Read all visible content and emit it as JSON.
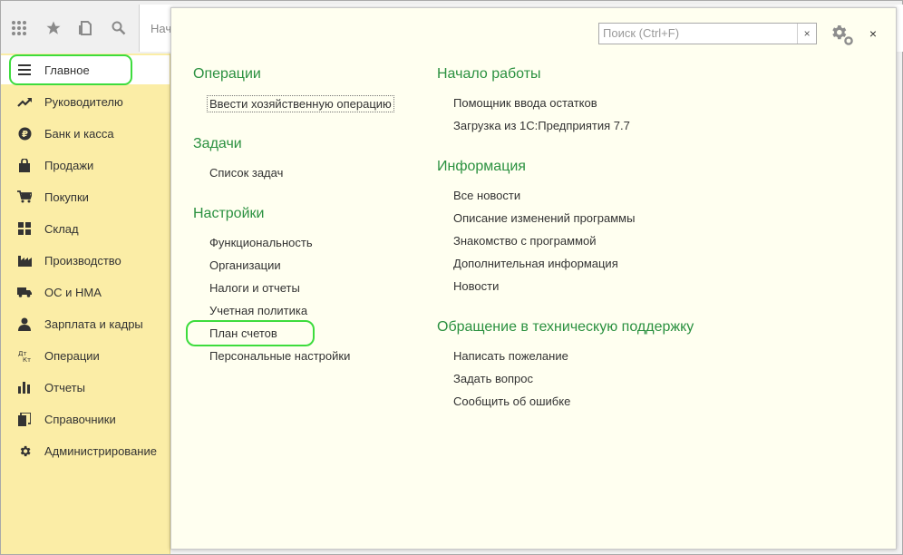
{
  "toolbar": {
    "icons": [
      "apps-grid-icon",
      "star-icon",
      "history-icon",
      "search-icon"
    ],
    "tab_label": "Нач"
  },
  "sidebar": {
    "items": [
      {
        "label": "Главное",
        "icon": "menu-lines-icon",
        "active": true
      },
      {
        "label": "Руководителю",
        "icon": "trend-icon"
      },
      {
        "label": "Банк и касса",
        "icon": "ruble-coin-icon"
      },
      {
        "label": "Продажи",
        "icon": "shopping-bag-icon"
      },
      {
        "label": "Покупки",
        "icon": "cart-icon"
      },
      {
        "label": "Склад",
        "icon": "warehouse-icon"
      },
      {
        "label": "Производство",
        "icon": "factory-icon"
      },
      {
        "label": "ОС и НМА",
        "icon": "truck-icon"
      },
      {
        "label": "Зарплата и кадры",
        "icon": "person-icon"
      },
      {
        "label": "Операции",
        "icon": "debit-credit-icon"
      },
      {
        "label": "Отчеты",
        "icon": "bar-chart-icon"
      },
      {
        "label": "Справочники",
        "icon": "books-icon"
      },
      {
        "label": "Администрирование",
        "icon": "gear-icon"
      }
    ]
  },
  "panel": {
    "search_placeholder": "Поиск (Ctrl+F)",
    "search_clear": "×",
    "close": "×",
    "left": {
      "operations": {
        "title": "Операции",
        "links": [
          "Ввести хозяйственную операцию"
        ]
      },
      "tasks": {
        "title": "Задачи",
        "links": [
          "Список задач"
        ]
      },
      "settings": {
        "title": "Настройки",
        "links": [
          "Функциональность",
          "Организации",
          "Налоги и отчеты",
          "Учетная политика",
          "План счетов",
          "Персональные настройки"
        ]
      }
    },
    "right": {
      "start": {
        "title": "Начало работы",
        "links": [
          "Помощник ввода остатков",
          "Загрузка из 1С:Предприятия 7.7"
        ]
      },
      "info": {
        "title": "Информация",
        "links": [
          "Все новости",
          "Описание изменений программы",
          "Знакомство с программой",
          "Дополнительная информация",
          "Новости"
        ]
      },
      "support": {
        "title": "Обращение в техническую поддержку",
        "links": [
          "Написать пожелание",
          "Задать вопрос",
          "Сообщить об ошибке"
        ]
      }
    }
  },
  "colors": {
    "accent_green": "#2b9140",
    "sidebar_bg": "#fbeda6",
    "panel_bg": "#fffff0",
    "highlight": "#3ddc3d"
  }
}
